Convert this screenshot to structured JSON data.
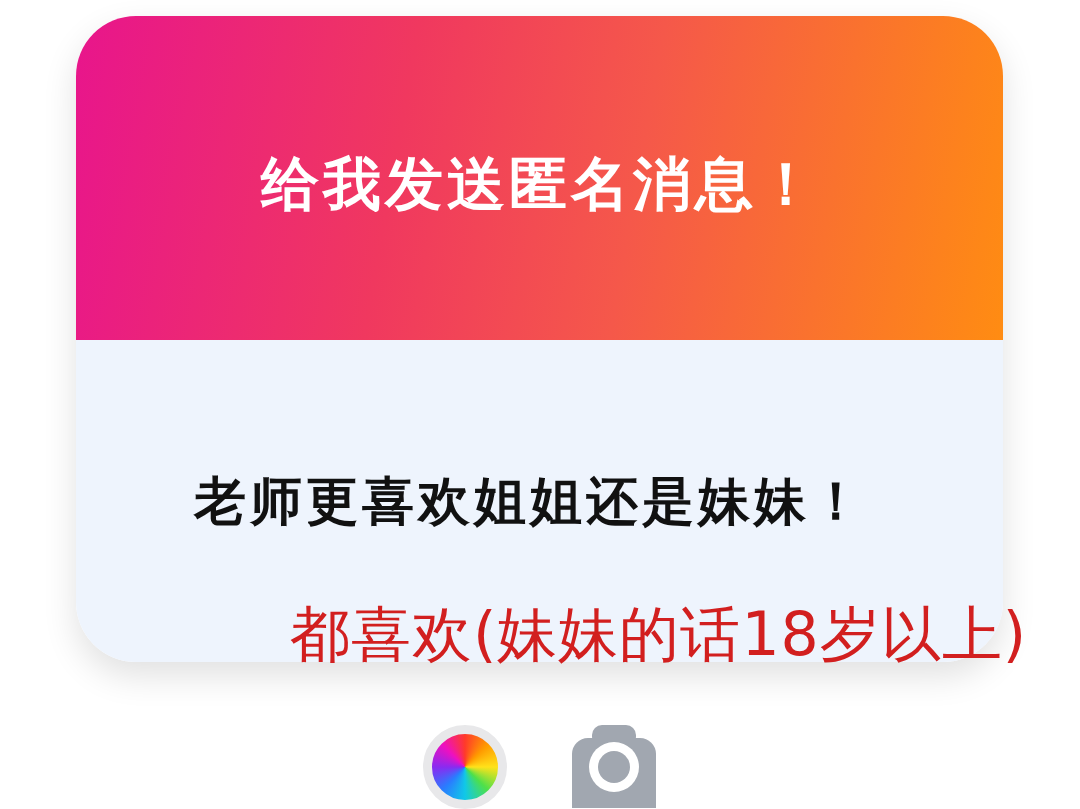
{
  "card": {
    "title": "给我发送匿名消息！",
    "message": "老师更喜欢姐姐还是妹妹！"
  },
  "overlay_note": {
    "text": "都喜欢(妹妹的话18岁以上)"
  }
}
